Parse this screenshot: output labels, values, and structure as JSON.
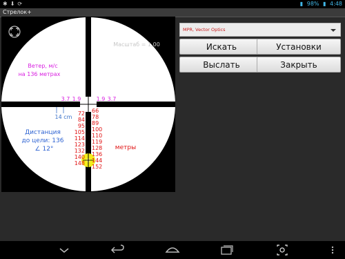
{
  "status_bar": {
    "battery_percent": "98%",
    "time": "4:48",
    "icons": [
      "usb-debug-icon",
      "download-icon",
      "sync-icon",
      "signal-icon",
      "battery-icon"
    ]
  },
  "app": {
    "title": "Стрелок+"
  },
  "reticle": {
    "scale_label": "Масштаб = 1,00",
    "wind_label_line1": "Ветер, м/с",
    "wind_label_line2": "на 136 метрах",
    "distance_line1": "Дистанция",
    "distance_line2": "до цели: 136",
    "distance_line3": "∠ 12°",
    "meters_label": "метры",
    "cm_label": "14 cm",
    "wind_left": [
      "3.7",
      "1.9"
    ],
    "wind_right": [
      "1.9",
      "3.7"
    ],
    "ranges_left": [
      "72",
      "84",
      "95",
      "105",
      "114",
      "123",
      "132",
      "140",
      "148"
    ],
    "ranges_right": [
      "66",
      "78",
      "89",
      "100",
      "110",
      "119",
      "128",
      "136",
      "144",
      "152"
    ],
    "colors": {
      "wind": "#d81ee0",
      "cm": "#3a72c9",
      "distance": "#2e63d2",
      "ranges": "#e01212",
      "scale": "#c7c7c7",
      "target": "#f4ee1c"
    }
  },
  "controls": {
    "scope_select_value": "MPR, Vector Optics",
    "search_label": "Искать",
    "settings_label": "Установки",
    "send_label": "Выслать",
    "close_label": "Закрыть"
  },
  "navbar": {
    "icons": [
      "back-chevron-icon",
      "back-icon",
      "home-icon",
      "recent-apps-icon",
      "screenshot-icon",
      "overflow-menu-icon"
    ]
  }
}
